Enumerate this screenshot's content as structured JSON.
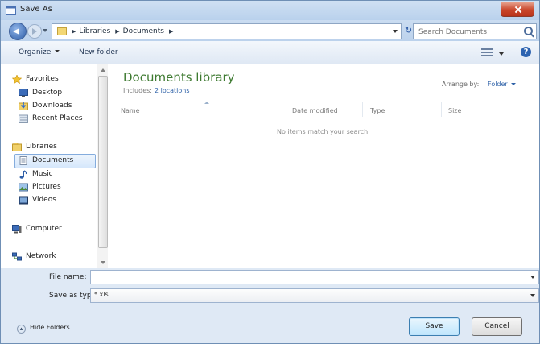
{
  "window": {
    "title": "Save As",
    "close_icon": "close-icon"
  },
  "address_bar": {
    "crumbs": [
      "Libraries",
      "Documents"
    ]
  },
  "search": {
    "placeholder": "Search Documents"
  },
  "toolbar": {
    "organize_label": "Organize",
    "new_folder_label": "New folder"
  },
  "nav_pane": {
    "favorites": {
      "label": "Favorites",
      "items": [
        "Desktop",
        "Downloads",
        "Recent Places"
      ]
    },
    "libraries": {
      "label": "Libraries",
      "items": [
        "Documents",
        "Music",
        "Pictures",
        "Videos"
      ],
      "selected": "Documents"
    },
    "computer": {
      "label": "Computer"
    },
    "network": {
      "label": "Network"
    }
  },
  "library": {
    "title": "Documents library",
    "includes_text": "Includes:",
    "locations_link": "2 locations",
    "arrange_by_label": "Arrange by:",
    "arrange_by_value": "Folder"
  },
  "columns": [
    "Name",
    "Date modified",
    "Type",
    "Size"
  ],
  "empty_message": "No items match your search.",
  "file_name": {
    "label": "File name:",
    "value": ""
  },
  "save_as_type": {
    "label": "Save as type:",
    "value": "*.xls"
  },
  "footer": {
    "hide_folders_label": "Hide Folders",
    "save_label": "Save",
    "cancel_label": "Cancel"
  },
  "colors": {
    "library_title": "#3e7a31",
    "link": "#2f62a8",
    "selection": "#d5e7fb",
    "close_button": "#c9462b"
  }
}
